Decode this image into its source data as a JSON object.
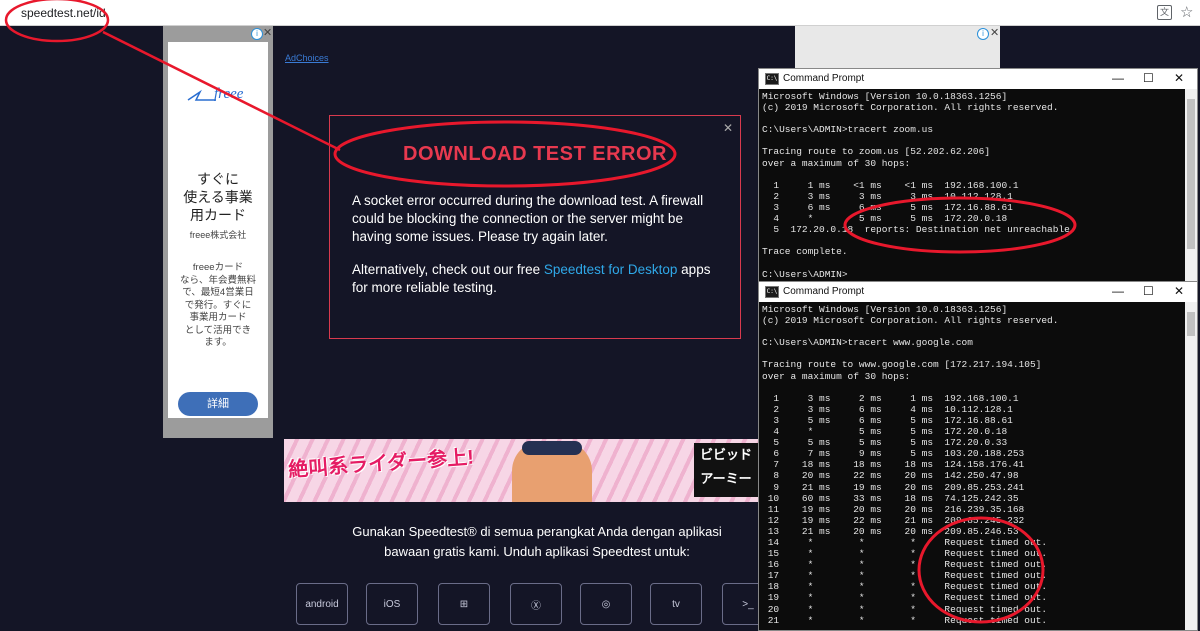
{
  "browser": {
    "url": "speedtest.net/id",
    "translate_icon": "translate-icon",
    "bookmark_icon": "star-icon"
  },
  "ad_left": {
    "logo": "freee",
    "title": "すぐに\n使える事業\n用カード",
    "company": "freee株式会社",
    "body": "freeeカード\nなら、年会費無料\nで、最短4営業日\nで発行。すぐに\n事業用カード\nとして活用でき\nます。",
    "button": "詳細"
  },
  "small_link": "AdChoices",
  "dialog": {
    "title": "DOWNLOAD TEST ERROR",
    "text": "A socket error occurred during the download test. A firewall could be blocking the connection or the server might be having some issues. Please try again later.",
    "text2_pre": "Alternatively, check out our free ",
    "text2_link": "Speedtest for Desktop",
    "text2_post": " apps for more reliable testing."
  },
  "banner": {
    "text": "絶叫系ライダー参上!",
    "logo": "ビビッドアーミー"
  },
  "apps": {
    "text": "Gunakan Speedtest® di semua perangkat Anda dengan aplikasi bawaan gratis kami. Unduh aplikasi Speedtest untuk:",
    "icons": [
      {
        "name": "android-app-icon",
        "label": "android"
      },
      {
        "name": "ios-app-icon",
        "label": "iOS"
      },
      {
        "name": "windows-app-icon",
        "label": "⊞"
      },
      {
        "name": "macos-app-icon",
        "label": "Ⓧ"
      },
      {
        "name": "chrome-app-icon",
        "label": "◎"
      },
      {
        "name": "appletv-app-icon",
        "label": "tv"
      },
      {
        "name": "cli-app-icon",
        "label": ">_"
      }
    ]
  },
  "cmd1": {
    "title": "Command Prompt",
    "text": "Microsoft Windows [Version 10.0.18363.1256]\n(c) 2019 Microsoft Corporation. All rights reserved.\n\nC:\\Users\\ADMIN>tracert zoom.us\n\nTracing route to zoom.us [52.202.62.206]\nover a maximum of 30 hops:\n\n  1     1 ms    <1 ms    <1 ms  192.168.100.1\n  2     3 ms     3 ms     3 ms  10.112.128.1\n  3     6 ms     6 ms     5 ms  172.16.88.61\n  4     *        5 ms     5 ms  172.20.0.18\n  5  172.20.0.18  reports: Destination net unreachable.\n\nTrace complete.\n\nC:\\Users\\ADMIN>"
  },
  "cmd2": {
    "title": "Command Prompt",
    "text": "Microsoft Windows [Version 10.0.18363.1256]\n(c) 2019 Microsoft Corporation. All rights reserved.\n\nC:\\Users\\ADMIN>tracert www.google.com\n\nTracing route to www.google.com [172.217.194.105]\nover a maximum of 30 hops:\n\n  1     3 ms     2 ms     1 ms  192.168.100.1\n  2     3 ms     6 ms     4 ms  10.112.128.1\n  3     5 ms     6 ms     5 ms  172.16.88.61\n  4     *        5 ms     5 ms  172.20.0.18\n  5     5 ms     5 ms     5 ms  172.20.0.33\n  6     7 ms     9 ms     5 ms  103.20.188.253\n  7    18 ms    18 ms    18 ms  124.158.176.41\n  8    20 ms    22 ms    20 ms  142.250.47.98\n  9    21 ms    19 ms    20 ms  209.85.253.241\n 10    60 ms    33 ms    18 ms  74.125.242.35\n 11    19 ms    20 ms    20 ms  216.239.35.168\n 12    19 ms    22 ms    21 ms  209.85.245.232\n 13    21 ms    20 ms    20 ms  209.85.246.53\n 14     *        *        *     Request timed out.\n 15     *        *        *     Request timed out.\n 16     *        *        *     Request timed out.\n 17     *        *        *     Request timed out.\n 18     *        *        *     Request timed out.\n 19     *        *        *     Request timed out.\n 20     *        *        *     Request timed out.\n 21     *        *        *     Request timed out."
  },
  "colors": {
    "annotation": "#e8182c",
    "page_bg": "#141526",
    "accent_red": "#e8394f",
    "link_blue": "#2fa8e8"
  }
}
